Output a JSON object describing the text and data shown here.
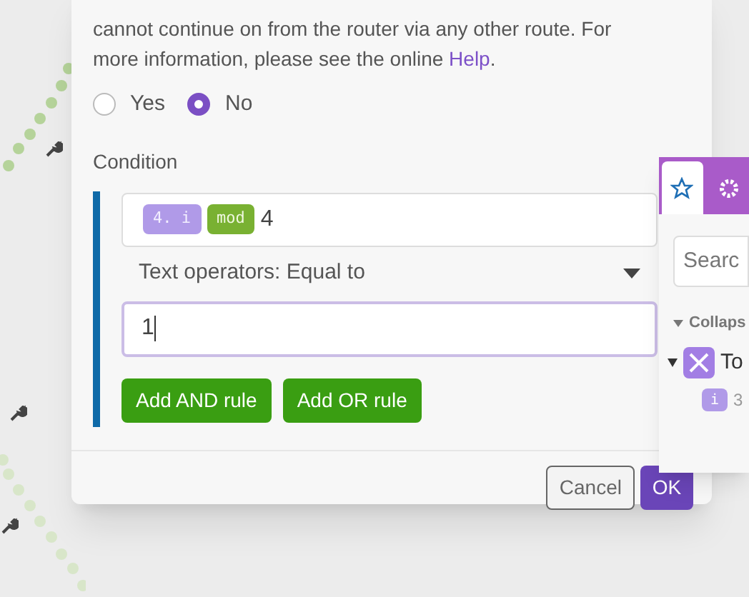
{
  "dialog": {
    "description_lines": [
      "cannot continue on from the router via any other route. For",
      "more information, please see the online "
    ],
    "help_link": "Help",
    "description_end": ".",
    "fallback_options": [
      {
        "label": "Yes",
        "selected": false
      },
      {
        "label": "No",
        "selected": true
      }
    ],
    "condition": {
      "label": "Condition",
      "operand_tokens": [
        {
          "kind": "variable",
          "text": "4. i"
        },
        {
          "kind": "function",
          "text": "mod"
        }
      ],
      "operand_text": "4",
      "operator": "Text operators: Equal to",
      "value": "1",
      "buttons": [
        "Add AND rule",
        "Add OR rule"
      ]
    },
    "footer_buttons": [
      {
        "label": "Cancel",
        "kind": "secondary"
      },
      {
        "label": "OK",
        "kind": "primary"
      }
    ]
  },
  "mapping_panel": {
    "tabs": [
      {
        "selected": true
      },
      {
        "selected": false
      }
    ],
    "search": {
      "placeholder": "Searc"
    },
    "section": "Collaps",
    "tree": [
      {
        "label": "To",
        "expanded": true,
        "children": [
          {
            "badge": "i",
            "label": "3"
          }
        ]
      }
    ]
  }
}
